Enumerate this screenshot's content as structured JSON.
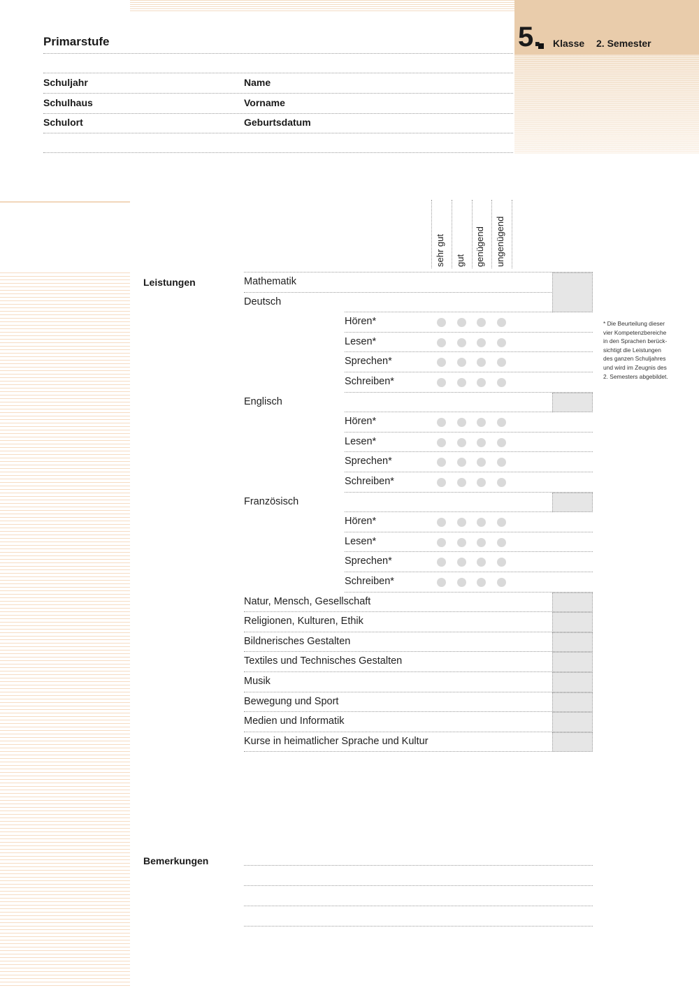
{
  "header": {
    "title": "Primarstufe",
    "class_number": "5.",
    "class_label": "Klasse",
    "semester": "2. Semester"
  },
  "info_fields": {
    "left": [
      "Schuljahr",
      "Schulhaus",
      "Schulort"
    ],
    "right": [
      "Name",
      "Vorname",
      "Geburtsdatum"
    ]
  },
  "rating_columns": [
    "sehr gut",
    "gut",
    "genügend",
    "ungenügend"
  ],
  "section_labels": {
    "performance": "Leistungen",
    "remarks": "Bemerkungen"
  },
  "subjects": {
    "mathematik": "Mathematik",
    "deutsch": "Deutsch",
    "englisch": "Englisch",
    "franzoesisch": "Französisch",
    "others": [
      "Natur, Mensch, Gesellschaft",
      "Religionen, Kulturen, Ethik",
      "Bildnerisches Gestalten",
      "Textiles und Technisches Gestalten",
      "Musik",
      "Bewegung und Sport",
      "Medien und Informatik",
      "Kurse in heimatlicher Sprache und Kultur"
    ]
  },
  "competences": [
    "Hören*",
    "Lesen*",
    "Sprechen*",
    "Schreiben*"
  ],
  "footnote": [
    "* Die Beurteilung dieser",
    "vier Kompetenzbereiche",
    "in den Sprachen berück-",
    "sichtigt die Leistungen",
    "des ganzen Schuljahres",
    "und wird im Zeugnis des",
    "2. Semesters abgebildet."
  ]
}
